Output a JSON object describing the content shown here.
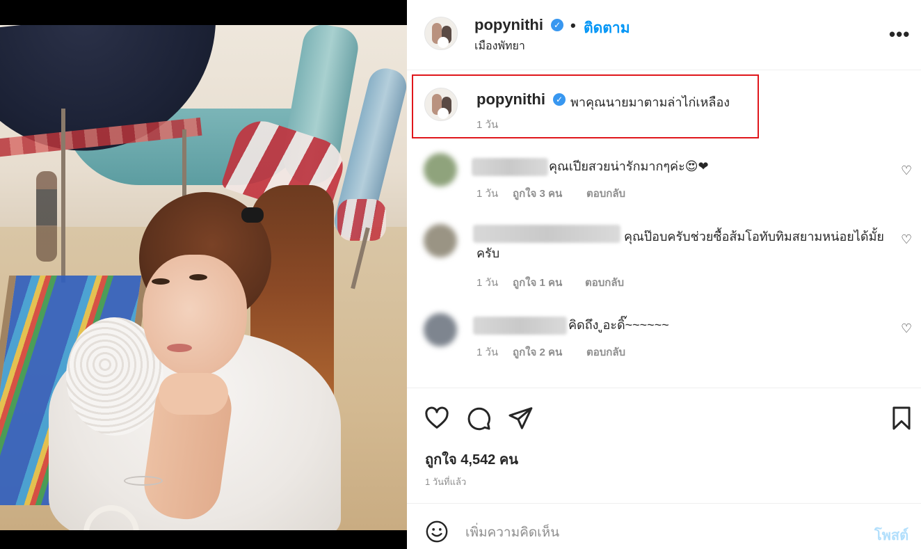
{
  "post": {
    "username": "popynithi",
    "separator": "•",
    "follow_label": "ติดตาม",
    "location": "เมืองพัทยา",
    "more_label": "•••",
    "verified_mark": "✓"
  },
  "caption": {
    "username": "popynithi",
    "text": "พาคุณนายมาตามล่าไก่เหลือง",
    "time": "1 วัน"
  },
  "comments": [
    {
      "text": "คุณเปียสวยน่ารักมากๆค่ะ😍❤",
      "time": "1 วัน",
      "likes": "ถูกใจ 3 คน",
      "reply": "ตอบกลับ",
      "avatar_color": "#8fa37c"
    },
    {
      "text": "คุณป๊อบครับช่วยซื้อส้มโอทับทิมสยามหน่อยได้มั้ยครับ",
      "time": "1 วัน",
      "likes": "ถูกใจ 1 คน",
      "reply": "ตอบกลับ",
      "avatar_color": "#9a9484"
    },
    {
      "text": "คิดถึง  ูอะดิ๊~~~~~~",
      "time": "1 วัน",
      "likes": "ถูกใจ 2 คน",
      "reply": "ตอบกลับ",
      "avatar_color": "#7e858f"
    }
  ],
  "actions": {
    "likes_count": "ถูกใจ 4,542 คน",
    "posted_time": "1 วันที่แล้ว"
  },
  "add_comment": {
    "placeholder": "เพิ่มความคิดเห็น",
    "post_label": "โพสต์"
  },
  "icons": {
    "like": "heart-icon",
    "comment": "comment-icon",
    "share": "share-icon",
    "save": "bookmark-icon",
    "emoji": "emoji-icon",
    "more": "more-icon"
  },
  "colors": {
    "accent": "#0095f6",
    "verified": "#3897f0",
    "highlight_box": "#e0161b",
    "post_disabled": "#b2dffc"
  }
}
